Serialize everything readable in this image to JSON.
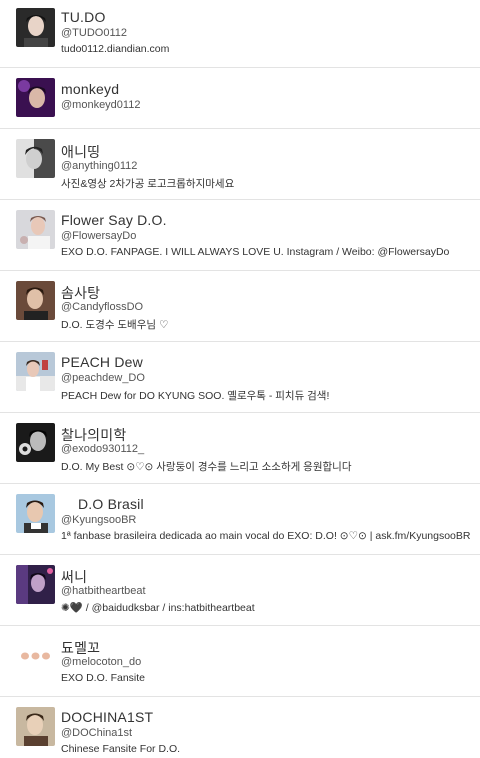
{
  "users": [
    {
      "name": "TU.DO",
      "handle": "@TUDO0112",
      "bio": "tudo0112.diandian.com",
      "avatar_bg": "#2a2a2a",
      "avatar_fg": "#e8d4c8",
      "avatar": "profile-photo"
    },
    {
      "name": "monkeyd",
      "handle": "@monkeyd0112",
      "bio": "",
      "avatar_bg": "#3a1050",
      "avatar_fg": "#d9b8a8",
      "avatar": "profile-photo"
    },
    {
      "name": "애니띵",
      "handle": "@anything0112",
      "bio": "사진&영상 2차가공 로고크롭하지마세요",
      "avatar_bg": "#4a4a4a",
      "avatar_fg": "#cfcfcf",
      "avatar": "profile-photo"
    },
    {
      "name": "Flower Say D.O.",
      "handle": "@FlowersayDo",
      "bio": "EXO D.O. FANPAGE. I WILL ALWAYS LOVE U. Instagram / Weibo: @FlowersayDo",
      "avatar_bg": "#d8d8dc",
      "avatar_fg": "#7a5a50",
      "avatar": "profile-photo"
    },
    {
      "name": "솜사탕",
      "handle": "@CandyflossDO",
      "bio": "D.O. 도경수 도배우님 ♡",
      "avatar_bg": "#6a4a3a",
      "avatar_fg": "#e0c0a8",
      "avatar": "profile-photo"
    },
    {
      "name": "PEACH Dew",
      "handle": "@peachdew_DO",
      "bio": "PEACH Dew for DO KYUNG SOO. 옐로우톡 - 피치듀 검색!",
      "avatar_bg": "#b8c8d8",
      "avatar_fg": "#c04040",
      "avatar": "profile-photo"
    },
    {
      "name": "찰나의미학",
      "handle": "@exodo930112_",
      "bio": "D.O. My Best ⊙♡⊙ 사랑둥이 경수를 느리고 소소하게 응원합니다",
      "avatar_bg": "#1a1a1a",
      "avatar_fg": "#bbbbbb",
      "avatar": "profile-photo"
    },
    {
      "name": "D.O Brasil",
      "handle": "@KyungsooBR",
      "bio": "1ª fanbase brasileira dedicada ao main vocal do EXO:  D.O!  ⊙♡⊙     | ask.fm/KyungsooBR",
      "avatar_bg": "#a8c8e0",
      "avatar_fg": "#5a4030",
      "avatar": "profile-photo"
    },
    {
      "name": "써니",
      "handle": "@hatbitheartbeat",
      "bio": "✺🖤 / @baidudksbar / ins:hatbitheartbeat",
      "avatar_bg": "#302048",
      "avatar_fg": "#c0a0c8",
      "avatar": "profile-photo"
    },
    {
      "name": "됴멜꼬",
      "handle": "@melocoton_do",
      "bio": "EXO D.O. Fansite",
      "avatar_bg": "#ffffff",
      "avatar_fg": "#e8b8a0",
      "avatar": "peach-logo"
    },
    {
      "name": "DOCHINA1ST",
      "handle": "@DOChina1st",
      "bio": "Chinese Fansite For D.O.",
      "avatar_bg": "#c8b8a0",
      "avatar_fg": "#5a4030",
      "avatar": "profile-photo"
    }
  ]
}
